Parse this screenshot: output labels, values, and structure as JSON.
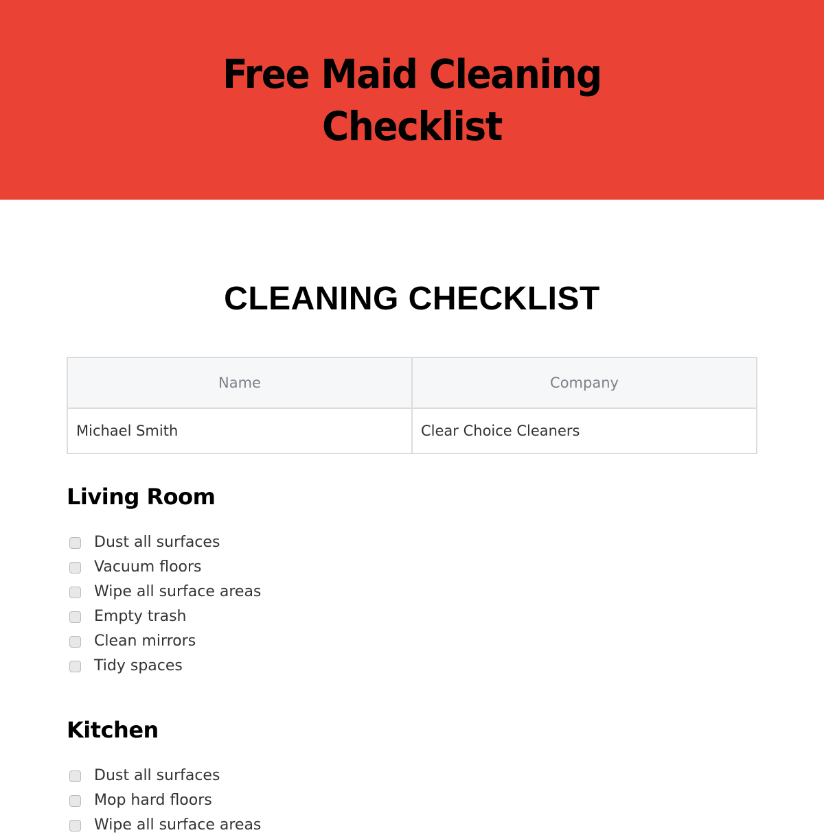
{
  "banner": {
    "title": "Free Maid Cleaning Checklist",
    "background_color": "#ea4335"
  },
  "document": {
    "title": "CLEANING CHECKLIST",
    "info_table": {
      "headers": [
        "Name",
        "Company"
      ],
      "row": [
        "Michael Smith",
        "Clear Choice Cleaners"
      ]
    },
    "sections": [
      {
        "heading": "Living Room",
        "items": [
          {
            "label": "Dust all surfaces",
            "checked": false
          },
          {
            "label": "Vacuum floors",
            "checked": false
          },
          {
            "label": "Wipe all surface areas",
            "checked": false
          },
          {
            "label": "Empty trash",
            "checked": false
          },
          {
            "label": "Clean mirrors",
            "checked": false
          },
          {
            "label": "Tidy spaces",
            "checked": false
          }
        ]
      },
      {
        "heading": "Kitchen",
        "items": [
          {
            "label": "Dust all surfaces",
            "checked": false
          },
          {
            "label": "Mop hard floors",
            "checked": false
          },
          {
            "label": "Wipe all surface areas",
            "checked": false
          }
        ]
      }
    ]
  }
}
